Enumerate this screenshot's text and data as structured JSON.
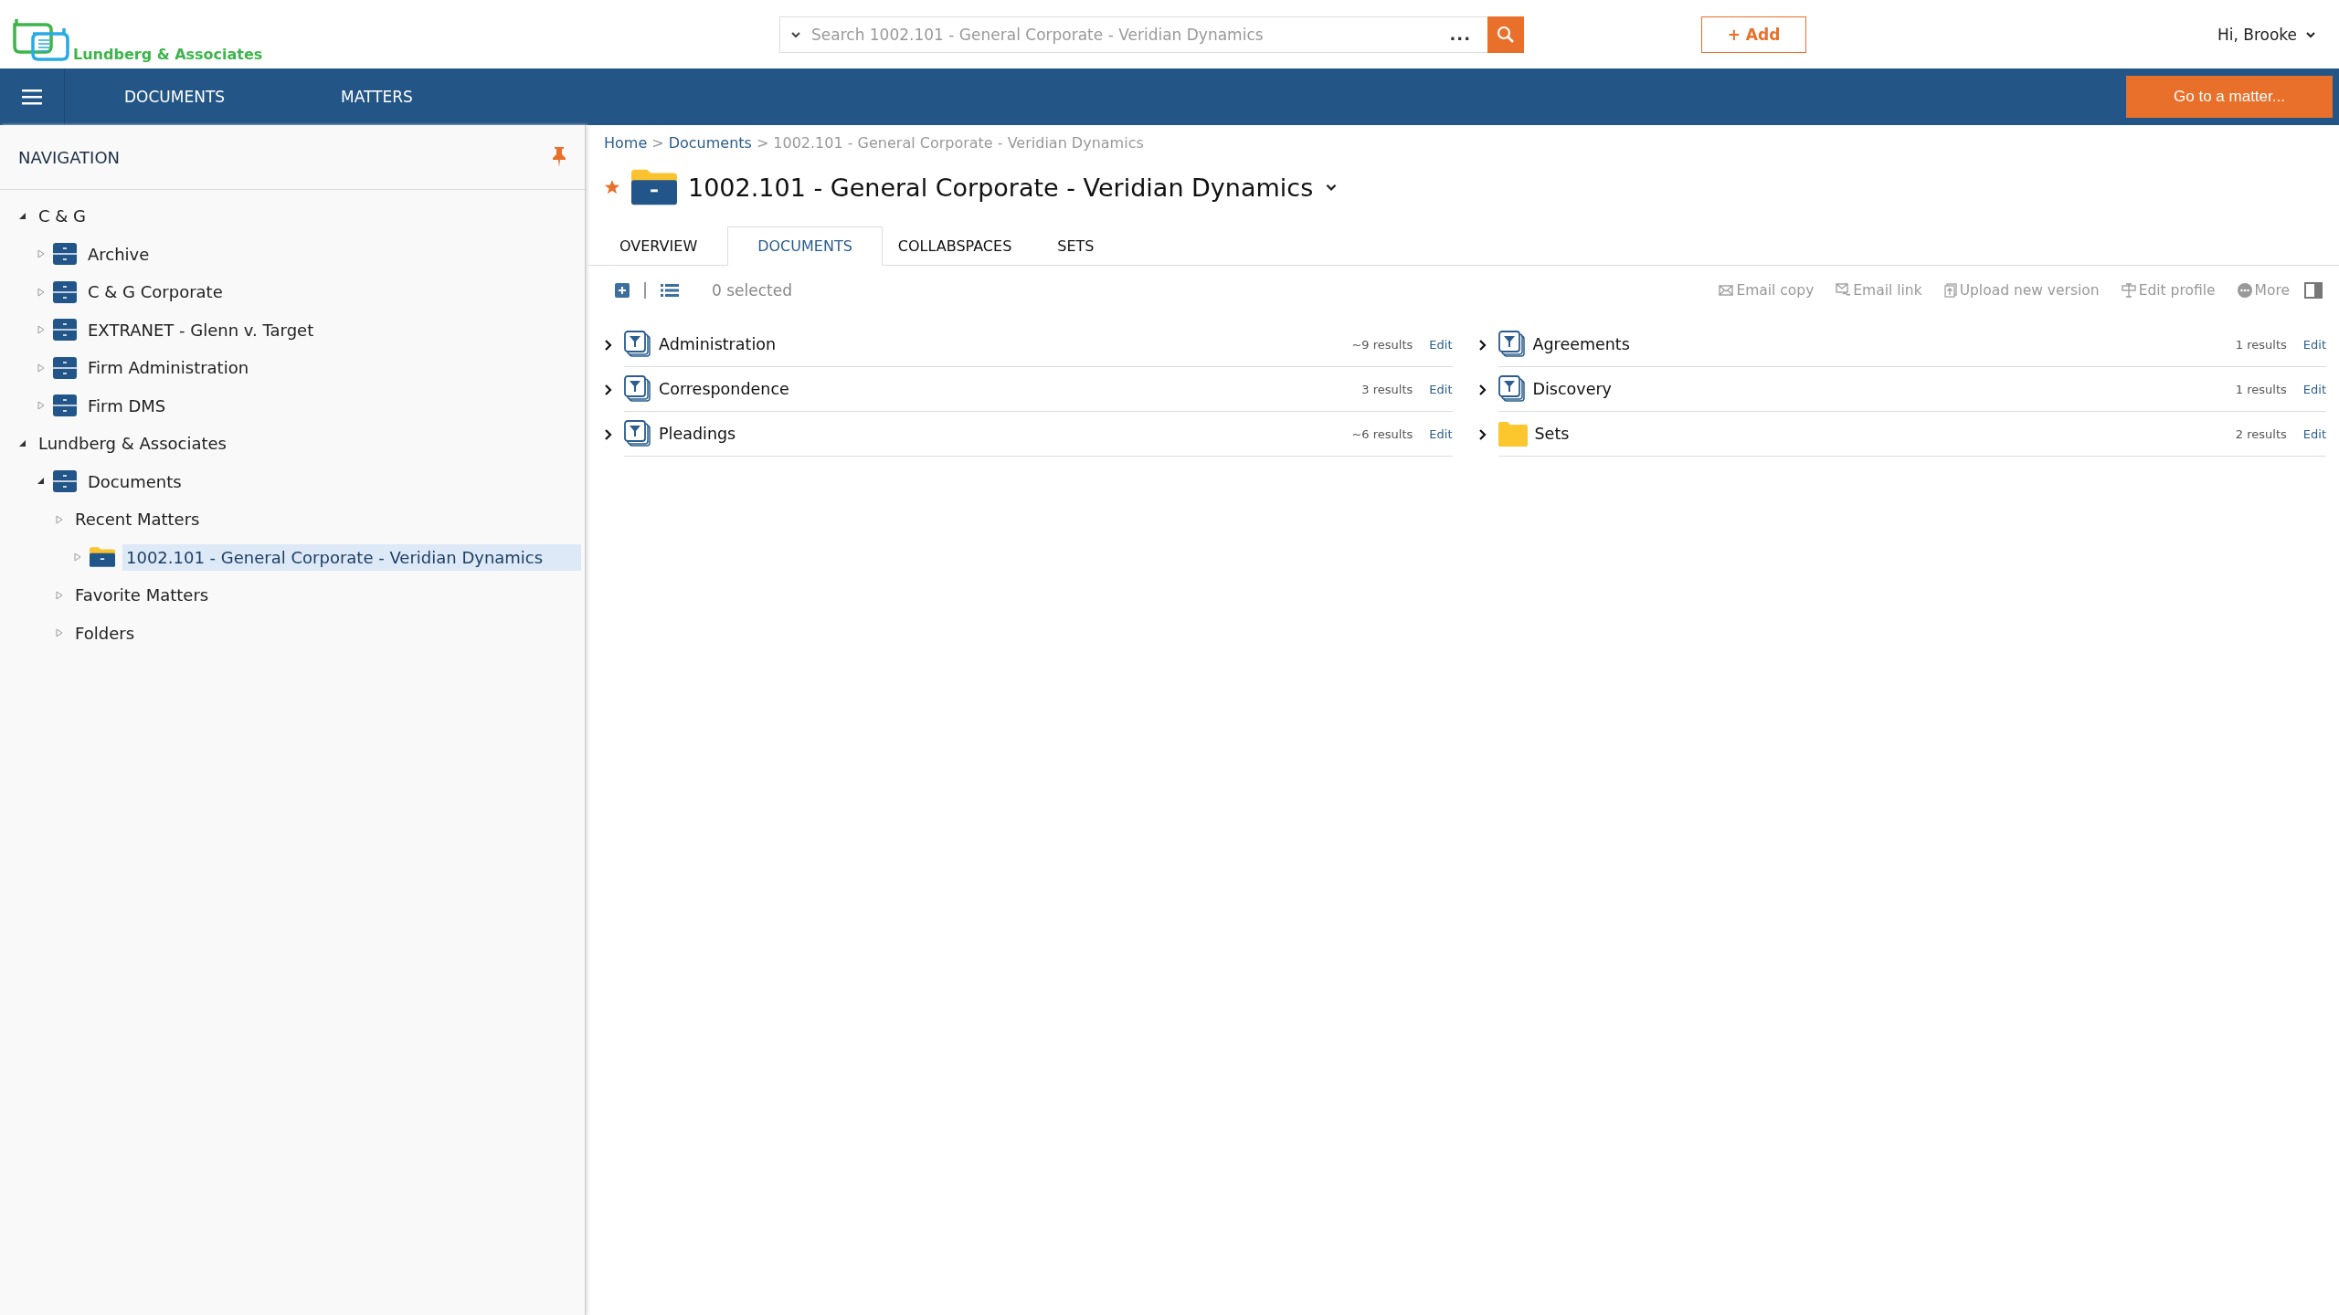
{
  "header": {
    "logo_text": "Lundberg & Associates",
    "search": {
      "placeholder": "Search 1002.101 - General Corporate - Veridian Dynamics",
      "more": "..."
    },
    "add_button": "+ Add",
    "user_menu": "Hi, Brooke"
  },
  "nav_bar": {
    "links": [
      "DOCUMENTS",
      "MATTERS"
    ],
    "go_button": "Go to a matter..."
  },
  "sidebar": {
    "title": "NAVIGATION",
    "tree": [
      {
        "label": "C & G",
        "expanded": true,
        "selected": false,
        "children": [
          {
            "label": "Archive",
            "kind": "cabinet",
            "expanded": false,
            "selected": false
          },
          {
            "label": "C & G Corporate",
            "kind": "cabinet",
            "expanded": false,
            "selected": false
          },
          {
            "label": "EXTRANET - Glenn v. Target",
            "kind": "cabinet",
            "expanded": false,
            "selected": false
          },
          {
            "label": "Firm Administration",
            "kind": "cabinet",
            "expanded": false,
            "selected": false
          },
          {
            "label": "Firm DMS",
            "kind": "cabinet",
            "expanded": false,
            "selected": false
          }
        ]
      },
      {
        "label": "Lundberg & Associates",
        "expanded": true,
        "selected": false,
        "children": [
          {
            "label": "Documents",
            "kind": "cabinet",
            "expanded": true,
            "selected": false,
            "children": [
              {
                "label": "Recent Matters",
                "expanded": false,
                "selected": false,
                "children": [
                  {
                    "label": "1002.101 - General Corporate - Veridian Dynamics",
                    "kind": "folder",
                    "expanded": false,
                    "selected": true
                  }
                ]
              },
              {
                "label": "Favorite Matters",
                "expanded": false,
                "selected": false
              },
              {
                "label": "Folders",
                "expanded": false,
                "selected": false
              }
            ]
          }
        ]
      }
    ]
  },
  "main": {
    "breadcrumb_separator": ">",
    "breadcrumb": [
      {
        "label": "Home",
        "link": true
      },
      {
        "label": "Documents",
        "link": true
      },
      {
        "label": "1002.101 - General Corporate - Veridian Dynamics",
        "link": false
      }
    ],
    "title": "1002.101 - General Corporate - Veridian Dynamics",
    "favorite": true,
    "tabs": [
      {
        "label": "OVERVIEW",
        "selected": false
      },
      {
        "label": "DOCUMENTS",
        "selected": true
      },
      {
        "label": "COLLABSPACES",
        "selected": false
      },
      {
        "label": "SETS",
        "selected": false
      }
    ],
    "toolbar": {
      "selection": "0 selected",
      "actions": [
        {
          "label": "Email copy",
          "kind": "email",
          "disabled": true
        },
        {
          "label": "Email link",
          "kind": "link",
          "disabled": true
        },
        {
          "label": "Upload new version",
          "kind": "upload",
          "disabled": true
        },
        {
          "label": "Edit profile",
          "kind": "profile",
          "disabled": true
        },
        {
          "label": "More",
          "kind": "more",
          "disabled": true
        }
      ]
    },
    "folders": [
      [
        {
          "name": "Administration",
          "kind": "search-folder",
          "results": "~9 results",
          "edit": "Edit"
        },
        {
          "name": "Correspondence",
          "kind": "search-folder",
          "results": "3 results",
          "edit": "Edit"
        },
        {
          "name": "Pleadings",
          "kind": "search-folder",
          "results": "~6 results",
          "edit": "Edit"
        }
      ],
      [
        {
          "name": "Agreements",
          "kind": "search-folder",
          "results": "1 results",
          "edit": "Edit"
        },
        {
          "name": "Discovery",
          "kind": "search-folder",
          "results": "1 results",
          "edit": "Edit"
        },
        {
          "name": "Sets",
          "kind": "folder",
          "results": "2 results",
          "edit": "Edit"
        }
      ]
    ]
  }
}
